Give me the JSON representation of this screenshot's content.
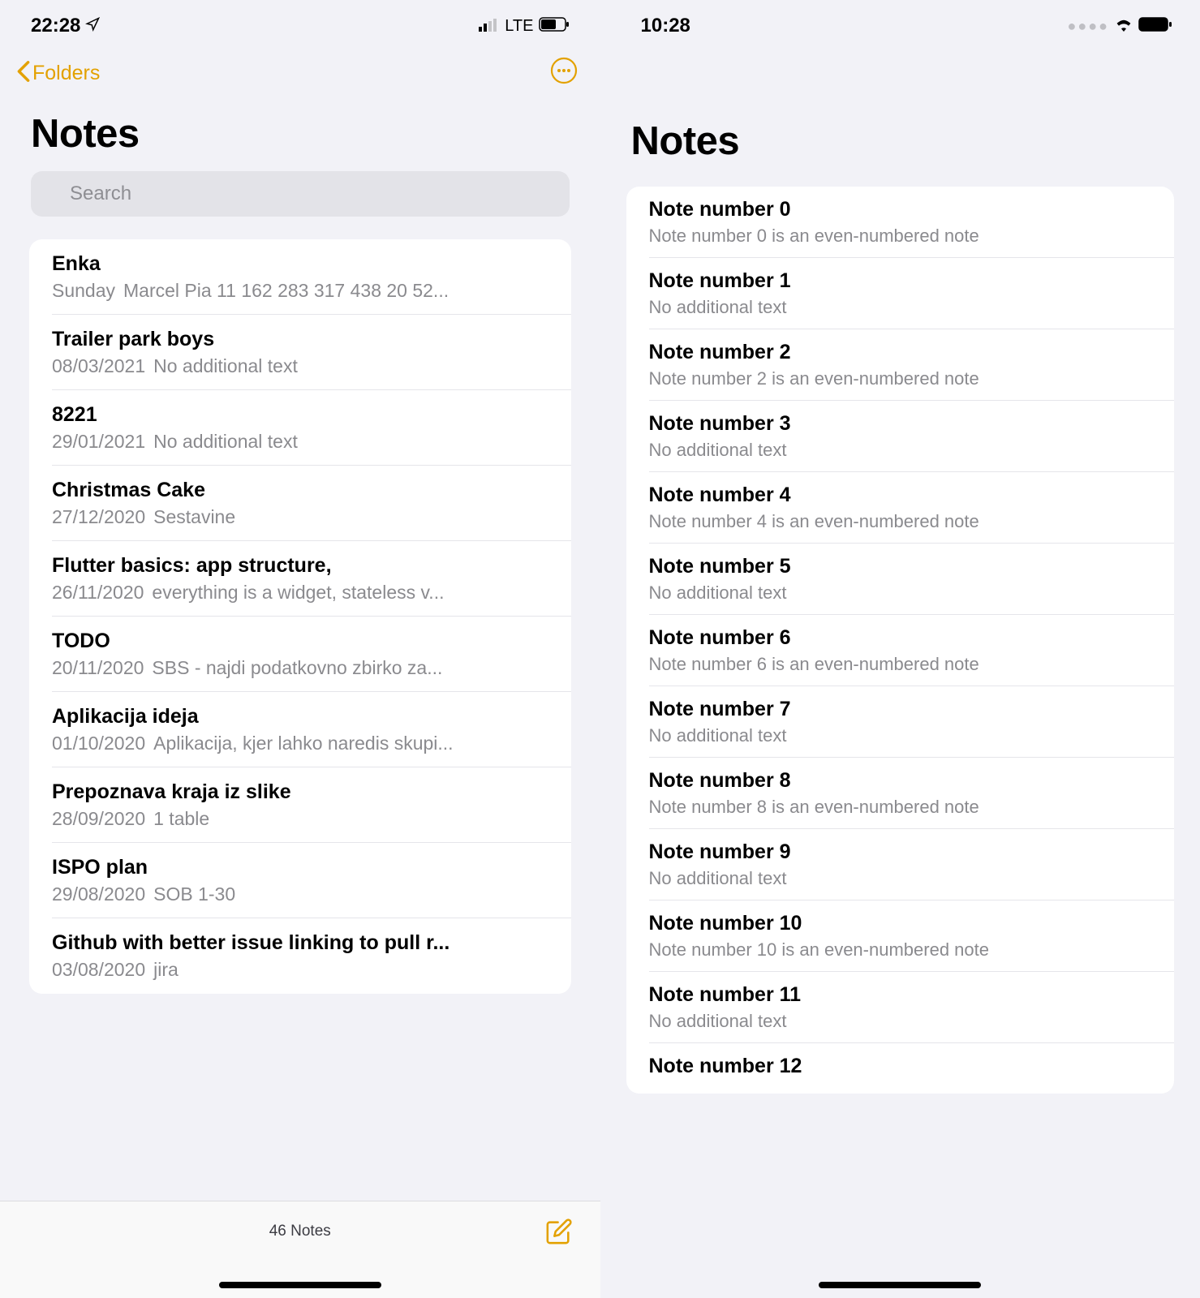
{
  "left": {
    "status_time": "22:28",
    "status_network": "LTE",
    "back_label": "Folders",
    "title": "Notes",
    "search_placeholder": "Search",
    "notes": [
      {
        "title": "Enka",
        "date": "Sunday",
        "preview": "Marcel Pia 11 162 283 317 438 20 52..."
      },
      {
        "title": "Trailer park boys",
        "date": "08/03/2021",
        "preview": "No additional text"
      },
      {
        "title": "8221",
        "date": "29/01/2021",
        "preview": "No additional text"
      },
      {
        "title": "Christmas Cake",
        "date": "27/12/2020",
        "preview": "Sestavine"
      },
      {
        "title": "Flutter basics: app structure,",
        "date": "26/11/2020",
        "preview": "everything is a widget, stateless v..."
      },
      {
        "title": "TODO",
        "date": "20/11/2020",
        "preview": "SBS - najdi podatkovno zbirko za..."
      },
      {
        "title": "Aplikacija ideja",
        "date": "01/10/2020",
        "preview": "Aplikacija, kjer lahko naredis skupi..."
      },
      {
        "title": "Prepoznava kraja iz slike",
        "date": "28/09/2020",
        "preview": "1 table"
      },
      {
        "title": "ISPO plan",
        "date": "29/08/2020",
        "preview": "SOB 1-30"
      },
      {
        "title": "Github with better issue linking to pull r...",
        "date": "03/08/2020",
        "preview": "jira"
      }
    ],
    "footer_count": "46 Notes"
  },
  "right": {
    "status_time": "10:28",
    "title": "Notes",
    "notes": [
      {
        "title": "Note number 0",
        "sub": "Note number 0 is an even-numbered note"
      },
      {
        "title": "Note number 1",
        "sub": "No additional text"
      },
      {
        "title": "Note number 2",
        "sub": "Note number 2 is an even-numbered note"
      },
      {
        "title": "Note number 3",
        "sub": "No additional text"
      },
      {
        "title": "Note number 4",
        "sub": "Note number 4 is an even-numbered note"
      },
      {
        "title": "Note number 5",
        "sub": "No additional text"
      },
      {
        "title": "Note number 6",
        "sub": "Note number 6 is an even-numbered note"
      },
      {
        "title": "Note number 7",
        "sub": "No additional text"
      },
      {
        "title": "Note number 8",
        "sub": "Note number 8 is an even-numbered note"
      },
      {
        "title": "Note number 9",
        "sub": "No additional text"
      },
      {
        "title": "Note number 10",
        "sub": "Note number 10 is an even-numbered note"
      },
      {
        "title": "Note number 11",
        "sub": "No additional text"
      },
      {
        "title": "Note number 12",
        "sub": ""
      }
    ]
  }
}
